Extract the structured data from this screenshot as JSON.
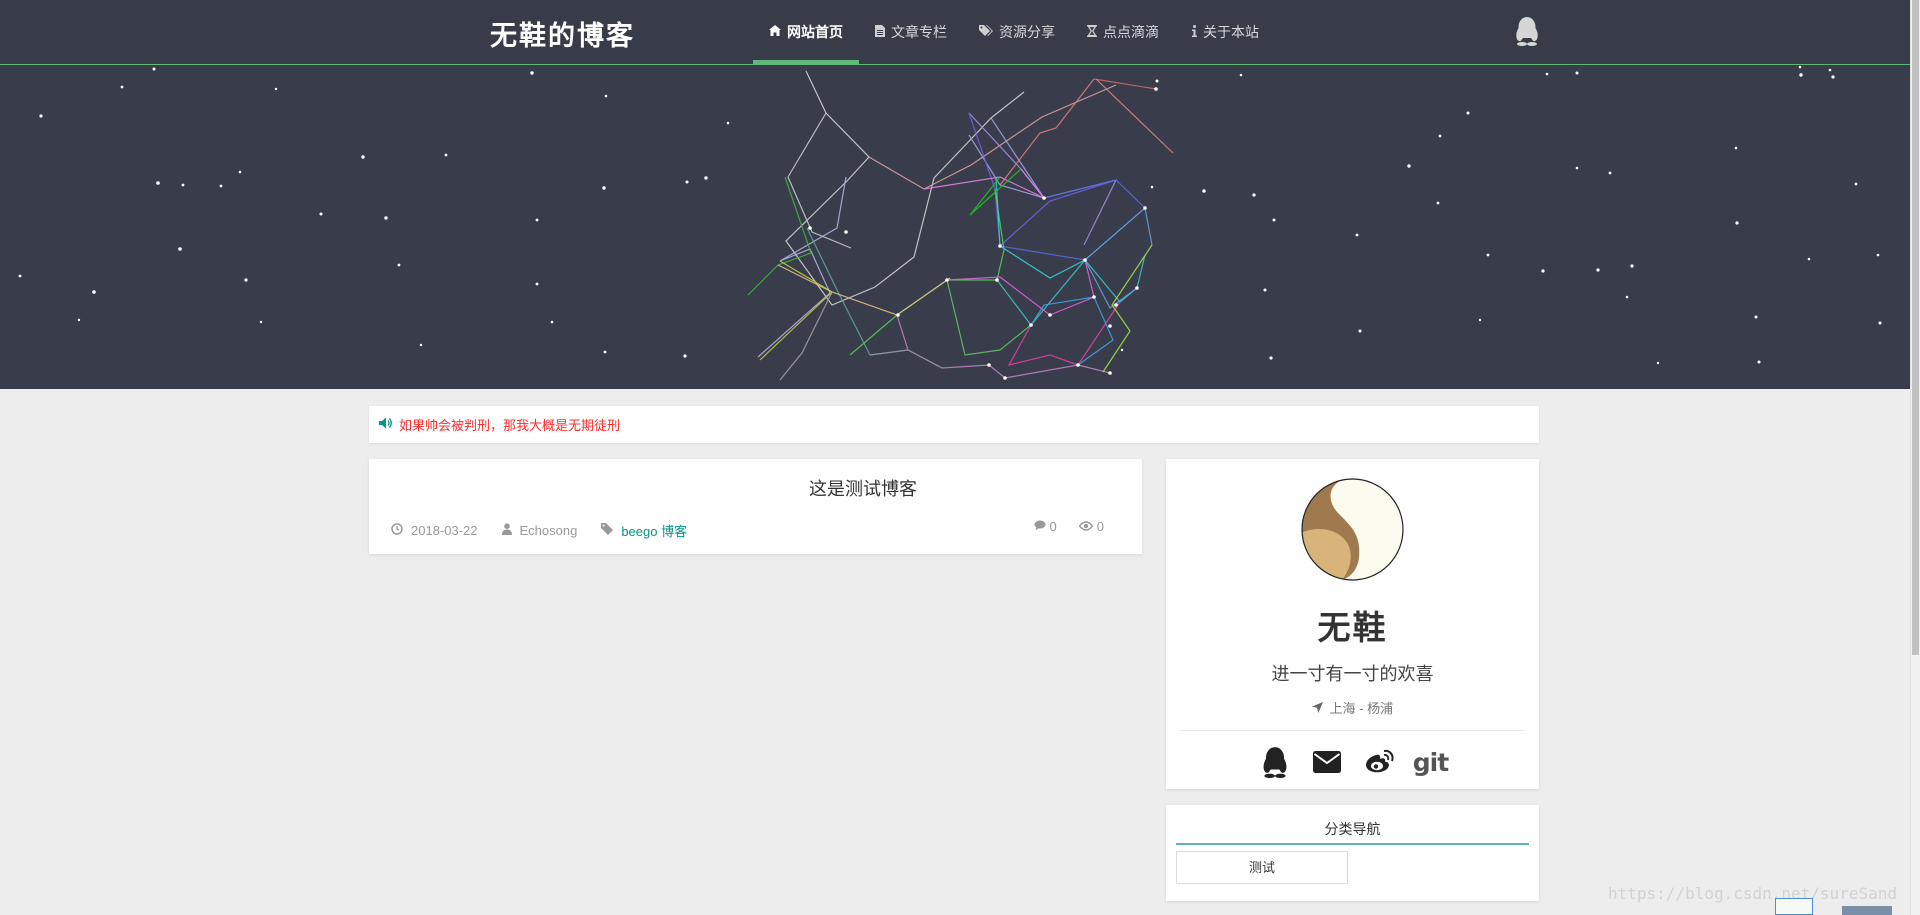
{
  "header": {
    "logo": "无鞋的博客",
    "nav": [
      {
        "icon": "home-icon",
        "label": "网站首页",
        "active": true
      },
      {
        "icon": "file-icon",
        "label": "文章专栏",
        "active": false
      },
      {
        "icon": "tags-icon",
        "label": "资源分享",
        "active": false
      },
      {
        "icon": "hourglass-icon",
        "label": "点点滴滴",
        "active": false
      },
      {
        "icon": "info-icon",
        "label": "关于本站",
        "active": false
      }
    ],
    "qq_icon": "qq-icon"
  },
  "notice": {
    "icon": "speaker-icon",
    "text": "如果帅会被判刑，那我大概是无期徒刑"
  },
  "article": {
    "title": "这是测试博客",
    "date": "2018-03-22",
    "author": "Echosong",
    "tags": "beego 博客",
    "comments": "0",
    "views": "0"
  },
  "profile": {
    "name": "无鞋",
    "motto": "进一寸有一寸的欢喜",
    "location": "上海 - 杨浦",
    "social": [
      "qq-icon",
      "envelope-icon",
      "weibo-icon",
      "git-icon"
    ],
    "git_label": "git"
  },
  "category": {
    "title": "分类导航",
    "items": [
      "测试"
    ]
  },
  "watermark": "https://blog.csdn.net/sureSand",
  "colors": {
    "header_bg": "#383c49",
    "accent_green": "#5fb878",
    "accent_teal": "#009688",
    "notice_red": "#ff2d2d",
    "page_bg": "#ededed"
  }
}
